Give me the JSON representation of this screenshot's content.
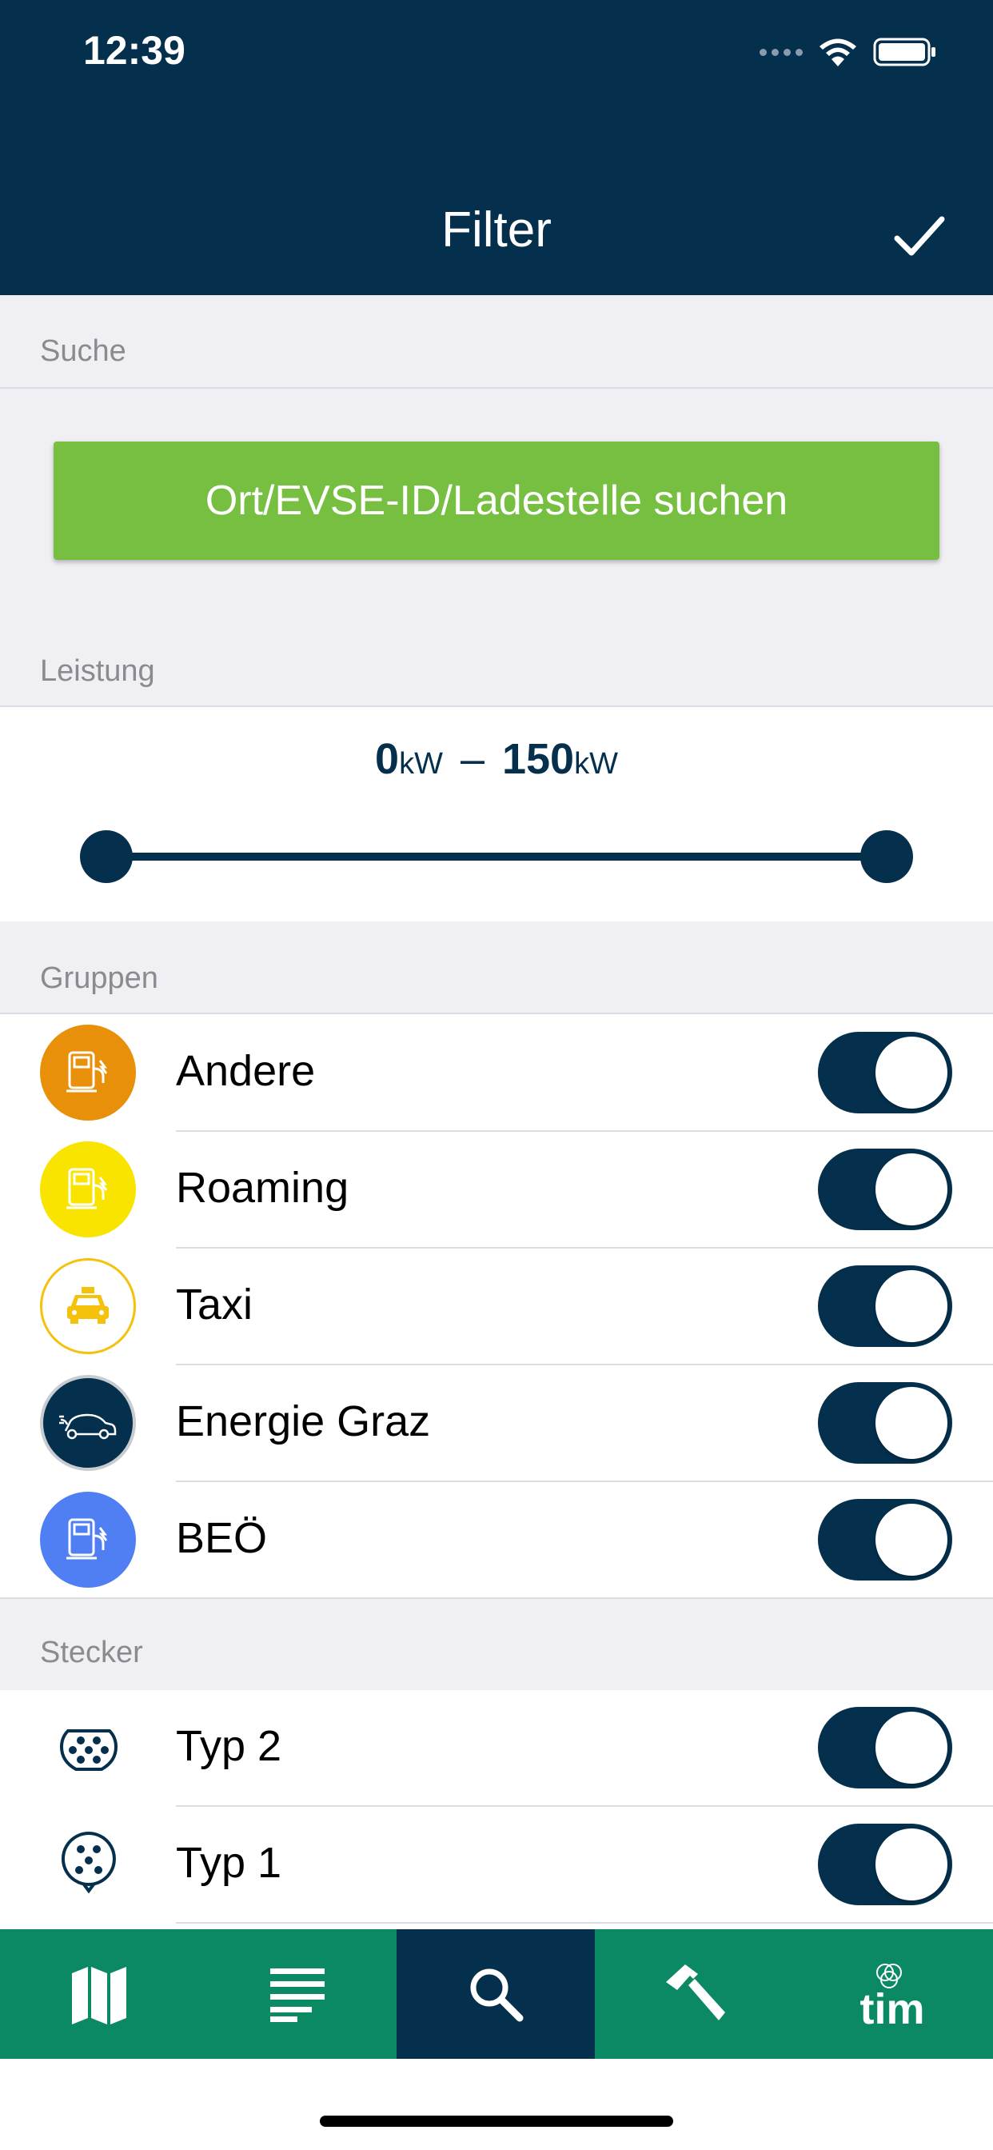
{
  "status_bar": {
    "time": "12:39"
  },
  "header": {
    "title": "Filter"
  },
  "sections": {
    "search": "Suche",
    "power": "Leistung",
    "groups": "Gruppen",
    "plugs": "Stecker"
  },
  "search": {
    "button_label": "Ort/EVSE-ID/Ladestelle suchen"
  },
  "power": {
    "min": "0",
    "max": "150",
    "unit": "kW",
    "separator": "–",
    "range_min_value": 0,
    "range_max_value": 150
  },
  "groups": [
    {
      "label": "Andere",
      "icon": "charging-station-icon",
      "color": "#e8900a",
      "enabled": true
    },
    {
      "label": "Roaming",
      "icon": "charging-station-icon",
      "color": "#f9e400",
      "enabled": true
    },
    {
      "label": "Taxi",
      "icon": "taxi-icon",
      "color": "#ffffff",
      "enabled": true
    },
    {
      "label": "Energie Graz",
      "icon": "electric-car-icon",
      "color": "#04304d",
      "enabled": true
    },
    {
      "label": "BEÖ",
      "icon": "charging-station-icon",
      "color": "#4f7ff3",
      "enabled": true
    }
  ],
  "plugs": [
    {
      "label": "Typ 2",
      "icon": "type2-plug-icon",
      "enabled": true
    },
    {
      "label": "Typ 1",
      "icon": "type1-plug-icon",
      "enabled": true
    }
  ],
  "tabbar": {
    "items": [
      "map-icon",
      "list-icon",
      "search-icon",
      "hammer-icon",
      "tim-logo"
    ],
    "active_index": 2,
    "logo_text": "tim"
  },
  "colors": {
    "header": "#04304d",
    "accent_green": "#77bf41",
    "tabbar": "#0b8864"
  }
}
